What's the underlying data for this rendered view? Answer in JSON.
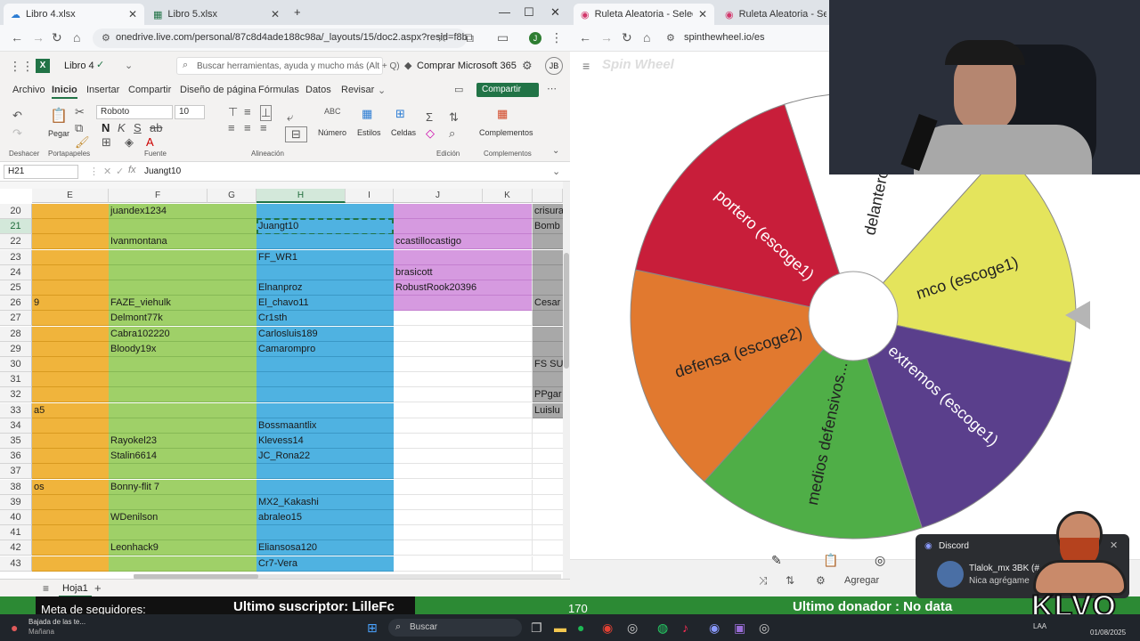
{
  "left_browser": {
    "tabs": [
      {
        "label": "Libro 4.xlsx",
        "active": true
      },
      {
        "label": "Libro 5.xlsx",
        "active": false
      }
    ],
    "url": "onedrive.live.com/personal/87c8d4ade188c98a/_layouts/15/doc2.aspx?resid=f8b74...",
    "profile_initial": "J"
  },
  "excel": {
    "doc_title": "Libro 4",
    "search_placeholder": "Buscar herramientas, ayuda y mucho más (Alt + Q)",
    "buy_label": "Comprar Microsoft 365",
    "user_initials": "JB",
    "ribbon_tabs": [
      "Archivo",
      "Inicio",
      "Insertar",
      "Compartir",
      "Diseño de página",
      "Fórmulas",
      "Datos",
      "Revisar"
    ],
    "share_label": "Compartir",
    "groups": {
      "undo": "Deshacer",
      "clipboard": "Portapapeles",
      "font": "Fuente",
      "alignment": "Alineación",
      "editing": "Edición",
      "addins": "Complementos"
    },
    "buttons": {
      "paste": "Pegar",
      "number": "Número",
      "styles": "Estilos",
      "cells": "Celdas",
      "addins": "Complementos"
    },
    "font_name": "Roboto",
    "font_size": "10",
    "name_box": "H21",
    "formula_value": "Juangt10",
    "columns": [
      "E",
      "F",
      "G",
      "H",
      "I",
      "J",
      "K"
    ],
    "rows": [
      {
        "n": "20",
        "e": "",
        "f": "juandex1234",
        "h": "",
        "j": "",
        "k": "crisura"
      },
      {
        "n": "21",
        "e": "",
        "f": "",
        "h": "Juangt10",
        "j": "",
        "k": "Bomb"
      },
      {
        "n": "22",
        "e": "",
        "f": "Ivanmontana",
        "h": "",
        "j": "ccastillocastigo",
        "k": ""
      },
      {
        "n": "23",
        "e": "",
        "f": "",
        "h": "FF_WR1",
        "j": "",
        "k": ""
      },
      {
        "n": "24",
        "e": "",
        "f": "",
        "h": "",
        "j": "brasicott",
        "k": ""
      },
      {
        "n": "25",
        "e": "",
        "f": "",
        "h": "Elnanproz",
        "j": "RobustRook20396",
        "k": ""
      },
      {
        "n": "26",
        "e": "9",
        "f": "FAZE_viehulk",
        "h": "El_chavo11",
        "j": "",
        "k": "Cesar"
      },
      {
        "n": "27",
        "e": "",
        "f": "Delmont77k",
        "h": "Cr1sth",
        "j": "",
        "k": ""
      },
      {
        "n": "28",
        "e": "",
        "f": "Cabra102220",
        "h": "Carlosluis189",
        "j": "",
        "k": ""
      },
      {
        "n": "29",
        "e": "",
        "f": "Bloody19x",
        "h": "Camarompro",
        "j": "",
        "k": ""
      },
      {
        "n": "30",
        "e": "",
        "f": "",
        "h": "",
        "j": "",
        "k": "FS SU"
      },
      {
        "n": "31",
        "e": "",
        "f": "",
        "h": "",
        "j": "",
        "k": ""
      },
      {
        "n": "32",
        "e": "",
        "f": "",
        "h": "",
        "j": "",
        "k": "PPgar"
      },
      {
        "n": "33",
        "e": "a5",
        "f": "",
        "h": "",
        "j": "",
        "k": "Luislu"
      },
      {
        "n": "34",
        "e": "",
        "f": "",
        "h": "Bossmaantlix",
        "j": "",
        "k": ""
      },
      {
        "n": "35",
        "e": "",
        "f": "Rayokel23",
        "h": "Klevess14",
        "j": "",
        "k": ""
      },
      {
        "n": "36",
        "e": "",
        "f": "Stalin6614",
        "h": "JC_Rona22",
        "j": "",
        "k": ""
      },
      {
        "n": "37",
        "e": "",
        "f": "",
        "h": "",
        "j": "",
        "k": ""
      },
      {
        "n": "38",
        "e": "os",
        "f": "Bonny-flit 7",
        "h": "",
        "j": "",
        "k": ""
      },
      {
        "n": "39",
        "e": "",
        "f": "",
        "h": "MX2_Kakashi",
        "j": "",
        "k": ""
      },
      {
        "n": "40",
        "e": "",
        "f": "WDenilson",
        "h": "abraleo15",
        "j": "",
        "k": ""
      },
      {
        "n": "41",
        "e": "",
        "f": "",
        "h": "",
        "j": "",
        "k": ""
      },
      {
        "n": "42",
        "e": "",
        "f": "Leonhack9",
        "h": "Eliansosa120",
        "j": "",
        "k": ""
      },
      {
        "n": "43",
        "e": "",
        "f": "",
        "h": "Cr7-Vera",
        "j": "",
        "k": ""
      }
    ],
    "sheet_tab": "Hoja1"
  },
  "right_browser": {
    "tabs": [
      "Ruleta Aleatoria - Selector Pers",
      "Ruleta Aleatoria - Selector Pe"
    ],
    "url": "spinthewheel.io/es",
    "logo": "Spin Wheel",
    "add_label": "Agregar"
  },
  "wheel": {
    "segments": [
      {
        "label": "delanteros",
        "color": "#ffffff"
      },
      {
        "label": "mco (escoge1)",
        "color": "#e4e45c"
      },
      {
        "label": "extremos (escoge1)",
        "color": "#5a3f8c"
      },
      {
        "label": "medios defensivos...",
        "color": "#4fae47"
      },
      {
        "label": "defensa (escoge2)",
        "color": "#e1792f"
      },
      {
        "label": "portero (escoge1)",
        "color": "#c81e3a"
      }
    ]
  },
  "overlay": {
    "followers_goal": "Meta de seguidores:",
    "last_sub": "Ultimo suscriptor: LilleFc",
    "count": "170",
    "last_donor": "Ultimo donador : No data",
    "brand": "KLVO"
  },
  "discord": {
    "app": "Discord",
    "user": "Tlalok_mx 3BK (#",
    "message": "Nica agrégame"
  },
  "taskbar": {
    "weather_title": "Bajada de las te...",
    "weather_sub": "Mañana",
    "search": "Buscar",
    "lang": "LAA",
    "date": "01/08/2025"
  },
  "colors": {
    "excel_green": "#217346",
    "col_e": "#f0b43c",
    "col_fg": "#9fd068",
    "col_hi": "#4fb2e1",
    "col_j": "#d69ae0",
    "col_k": "#a8a8a8"
  }
}
